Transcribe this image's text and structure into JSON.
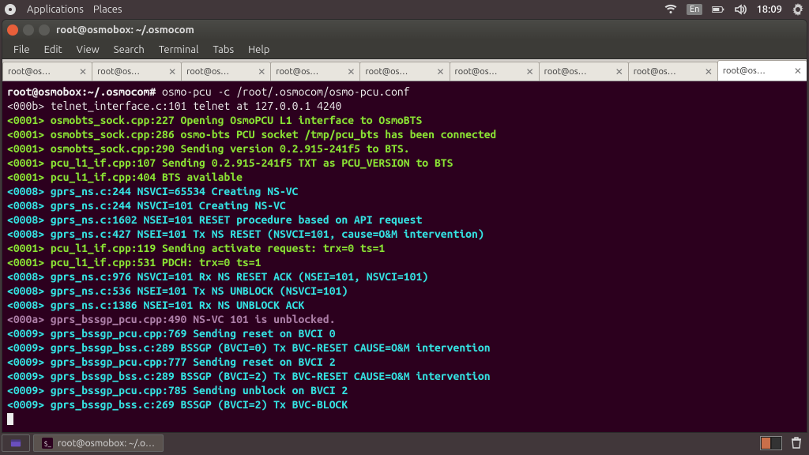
{
  "topbar": {
    "menus": [
      "Applications",
      "Places"
    ],
    "lang": "En",
    "clock": "18:09"
  },
  "window": {
    "title": "root@osmobox: ~/.osmocom",
    "menus": [
      "File",
      "Edit",
      "View",
      "Search",
      "Terminal",
      "Tabs",
      "Help"
    ],
    "tabs": [
      {
        "label": "root@os…",
        "active": false
      },
      {
        "label": "root@os…",
        "active": false
      },
      {
        "label": "root@os…",
        "active": false
      },
      {
        "label": "root@os…",
        "active": false
      },
      {
        "label": "root@os…",
        "active": false
      },
      {
        "label": "root@os…",
        "active": false
      },
      {
        "label": "root@os…",
        "active": false
      },
      {
        "label": "root@os…",
        "active": false
      },
      {
        "label": "root@os…",
        "active": true
      }
    ]
  },
  "terminal": {
    "prompt": "root@osmobox:~/.osmocom#",
    "command": "osmo-pcu -c /root/.osmocom/osmo-pcu.conf",
    "lines": [
      {
        "tag": "<000b>",
        "cls": "t-white",
        "text": "telnet_interface.c:101 telnet at 127.0.0.1 4240"
      },
      {
        "tag": "<0001>",
        "cls": "t-green t-bold",
        "text": "osmobts_sock.cpp:227 Opening OsmoPCU L1 interface to OsmoBTS"
      },
      {
        "tag": "<0001>",
        "cls": "t-green t-bold",
        "text": "osmobts_sock.cpp:286 osmo-bts PCU socket /tmp/pcu_bts has been connected"
      },
      {
        "tag": "<0001>",
        "cls": "t-green t-bold",
        "text": "osmobts_sock.cpp:290 Sending version 0.2.915-241f5 to BTS."
      },
      {
        "tag": "<0001>",
        "cls": "t-green t-bold",
        "text": "pcu_l1_if.cpp:107 Sending 0.2.915-241f5 TXT as PCU_VERSION to BTS"
      },
      {
        "tag": "<0001>",
        "cls": "t-green t-bold",
        "text": "pcu_l1_if.cpp:404 BTS available"
      },
      {
        "tag": "<0008>",
        "cls": "t-cyan t-bold",
        "text": "gprs_ns.c:244 NSVCI=65534 Creating NS-VC"
      },
      {
        "tag": "<0008>",
        "cls": "t-cyan t-bold",
        "text": "gprs_ns.c:244 NSVCI=101 Creating NS-VC"
      },
      {
        "tag": "<0008>",
        "cls": "t-cyan t-bold",
        "text": "gprs_ns.c:1602 NSEI=101 RESET procedure based on API request"
      },
      {
        "tag": "<0008>",
        "cls": "t-cyan t-bold",
        "text": "gprs_ns.c:427 NSEI=101 Tx NS RESET (NSVCI=101, cause=O&M intervention)"
      },
      {
        "tag": "<0001>",
        "cls": "t-green t-bold",
        "text": "pcu_l1_if.cpp:119 Sending activate request: trx=0 ts=1"
      },
      {
        "tag": "<0001>",
        "cls": "t-green t-bold",
        "text": "pcu_l1_if.cpp:531 PDCH: trx=0 ts=1"
      },
      {
        "tag": "<0008>",
        "cls": "t-cyan t-bold",
        "text": "gprs_ns.c:976 NSVCI=101 Rx NS RESET ACK (NSEI=101, NSVCI=101)"
      },
      {
        "tag": "<0008>",
        "cls": "t-cyan t-bold",
        "text": "gprs_ns.c:536 NSEI=101 Tx NS UNBLOCK (NSVCI=101)"
      },
      {
        "tag": "<0008>",
        "cls": "t-cyan t-bold",
        "text": "gprs_ns.c:1386 NSEI=101 Rx NS UNBLOCK ACK"
      },
      {
        "tag": "<000a>",
        "cls": "t-magenta t-bold",
        "text": "gprs_bssgp_pcu.cpp:490 NS-VC 101 is unblocked."
      },
      {
        "tag": "<0009>",
        "cls": "t-cyan t-bold",
        "text": "gprs_bssgp_pcu.cpp:769 Sending reset on BVCI 0"
      },
      {
        "tag": "<0009>",
        "cls": "t-cyan t-bold",
        "text": "gprs_bssgp_bss.c:289 BSSGP (BVCI=0) Tx BVC-RESET CAUSE=O&M intervention"
      },
      {
        "tag": "<0009>",
        "cls": "t-cyan t-bold",
        "text": "gprs_bssgp_pcu.cpp:777 Sending reset on BVCI 2"
      },
      {
        "tag": "<0009>",
        "cls": "t-cyan t-bold",
        "text": "gprs_bssgp_bss.c:289 BSSGP (BVCI=2) Tx BVC-RESET CAUSE=O&M intervention"
      },
      {
        "tag": "<0009>",
        "cls": "t-cyan t-bold",
        "text": "gprs_bssgp_pcu.cpp:785 Sending unblock on BVCI 2"
      },
      {
        "tag": "<0009>",
        "cls": "t-cyan t-bold",
        "text": "gprs_bssgp_bss.c:269 BSSGP (BVCI=2) Tx BVC-BLOCK"
      }
    ]
  },
  "taskbar": {
    "task_label": "root@osmobox: ~/.o…"
  }
}
